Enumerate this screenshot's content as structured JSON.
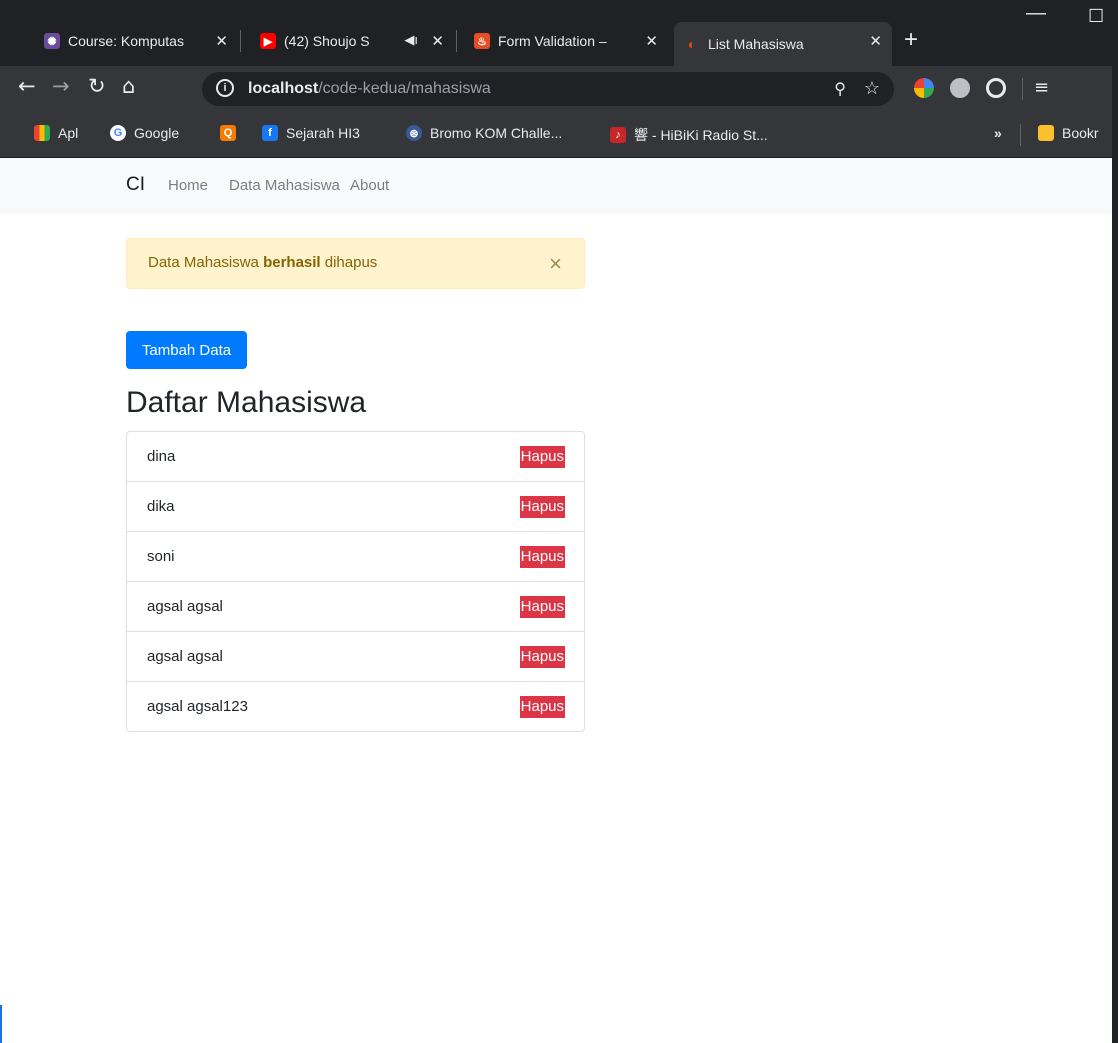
{
  "tabs": [
    {
      "title": "Course: Komputas",
      "favicon_color": "#6b4c9a"
    },
    {
      "title": "(42) Shoujo S",
      "favicon_color": "#ff0000"
    },
    {
      "title": "Form Validation – ",
      "favicon_color": "#e44d26"
    },
    {
      "title": "List Mahasiswa",
      "favicon_color": "#dd4814",
      "active": true
    }
  ],
  "toolbar": {
    "url_host": "localhost",
    "url_path": "/code-kedua/mahasiswa"
  },
  "bookmarks": [
    {
      "label": "Apl",
      "icon": "apps-grid-icon"
    },
    {
      "label": "Google",
      "icon": "google-icon"
    },
    {
      "label": "",
      "icon": "search-extension-icon"
    },
    {
      "label": "Sejarah HI3",
      "icon": "facebook-icon"
    },
    {
      "label": "Bromo KOM Challe...",
      "icon": "strava-icon"
    },
    {
      "label": "響 - HiBiKi Radio St...",
      "icon": "hibiki-icon"
    },
    {
      "label": "Bookr",
      "icon": "folder-icon"
    }
  ],
  "navbar": {
    "brand": "CI",
    "links": [
      "Home",
      "Data Mahasiswa",
      "About"
    ]
  },
  "alert": {
    "prefix": "Data Mahasiswa ",
    "bold": "berhasil",
    "suffix": " dihapus",
    "close": "×"
  },
  "add_button": "Tambah Data",
  "heading": "Daftar Mahasiswa",
  "students": [
    {
      "name": "dina",
      "action": "Hapus"
    },
    {
      "name": "dika",
      "action": "Hapus"
    },
    {
      "name": "soni",
      "action": "Hapus"
    },
    {
      "name": "agsal agsal",
      "action": "Hapus"
    },
    {
      "name": "agsal agsal",
      "action": "Hapus"
    },
    {
      "name": "agsal agsal123",
      "action": "Hapus"
    }
  ],
  "colors": {
    "primary": "#007bff",
    "danger": "#dc3545",
    "warning_bg": "#fff3cd",
    "warning_text": "#856404"
  }
}
